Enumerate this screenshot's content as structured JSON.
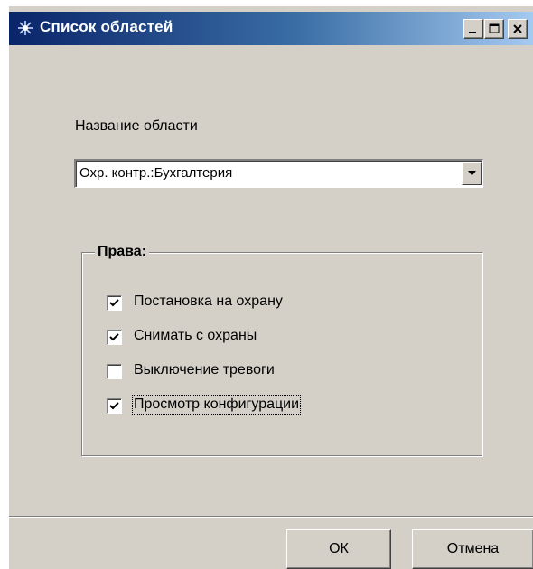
{
  "window": {
    "title": "Список областей",
    "icon": "star-burst-icon"
  },
  "titlebar_buttons": {
    "minimize": "minimize-icon",
    "maximize": "maximize-icon",
    "close": "close-icon"
  },
  "area": {
    "label": "Название области",
    "selected_value": "Охр. контр.:Бухгалтерия"
  },
  "rights": {
    "legend": "Права:",
    "items": [
      {
        "label": "Постановка на охрану",
        "checked": true
      },
      {
        "label": "Снимать с охраны",
        "checked": true
      },
      {
        "label": "Выключение тревоги",
        "checked": false
      },
      {
        "label": "Просмотр конфигурации",
        "checked": true,
        "focused": true
      }
    ]
  },
  "buttons": {
    "ok": "ОК",
    "cancel": "Отмена"
  },
  "colors": {
    "face": "#d4d0c8",
    "title_start": "#0a246a",
    "title_end": "#a6caf0"
  }
}
